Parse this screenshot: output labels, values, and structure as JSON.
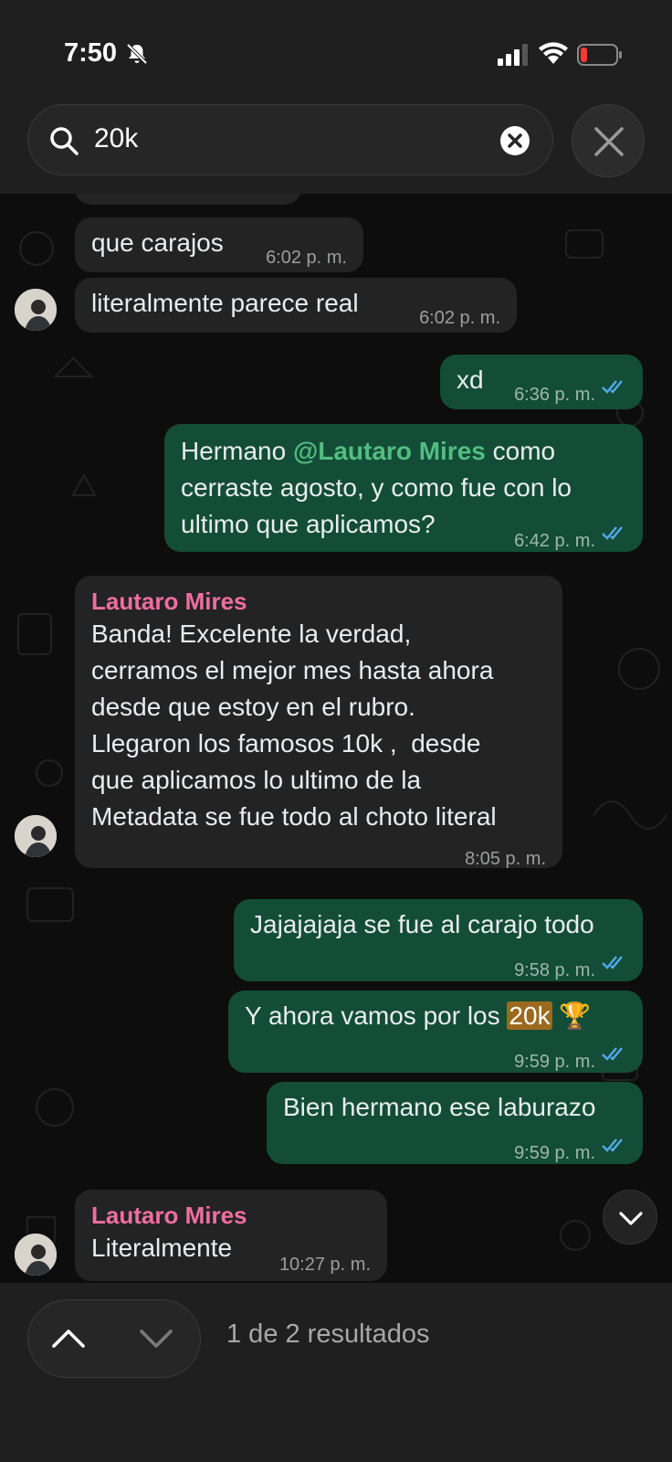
{
  "status_bar": {
    "time": "7:50"
  },
  "search": {
    "query": "20k"
  },
  "messages": [
    {
      "text": "que carajos",
      "time": "6:02 p. m."
    },
    {
      "text": "literalmente parece real",
      "time": "6:02 p. m."
    },
    {
      "text": "xd",
      "time": "6:36 p. m."
    },
    {
      "text_pre": "Hermano ",
      "mention": "@Lautaro Mires",
      "text_post_1": " como",
      "line2": "cerraste agosto, y como fue con lo",
      "line3": "ultimo que aplicamos?",
      "time": "6:42 p. m."
    },
    {
      "sender": "Lautaro Mires",
      "lines": [
        "Banda! Excelente la verdad,",
        "cerramos el mejor mes hasta ahora",
        "desde que estoy en el rubro.",
        "Llegaron los famosos 10k ,  desde",
        "que aplicamos lo ultimo de la",
        "Metadata se fue todo al choto literal"
      ],
      "time": "8:05 p. m."
    },
    {
      "text": "Jajajajaja se fue al carajo todo",
      "time": "9:58 p. m."
    },
    {
      "text_pre": "Y ahora vamos por los ",
      "highlight": "20k",
      "emoji": "🏆",
      "time": "9:59 p. m."
    },
    {
      "text": "Bien hermano ese laburazo",
      "time": "9:59 p. m."
    },
    {
      "sender": "Lautaro Mires",
      "text": "Literalmente",
      "time": "10:27 p. m."
    }
  ],
  "results": "1 de 2 resultados",
  "colors": {
    "outgoing": "#134d37",
    "incoming": "#232323",
    "mention": "#53bd81",
    "sender": "#f06ea0",
    "highlight": "#9b6a1f",
    "ticks": "#53a9eb"
  }
}
